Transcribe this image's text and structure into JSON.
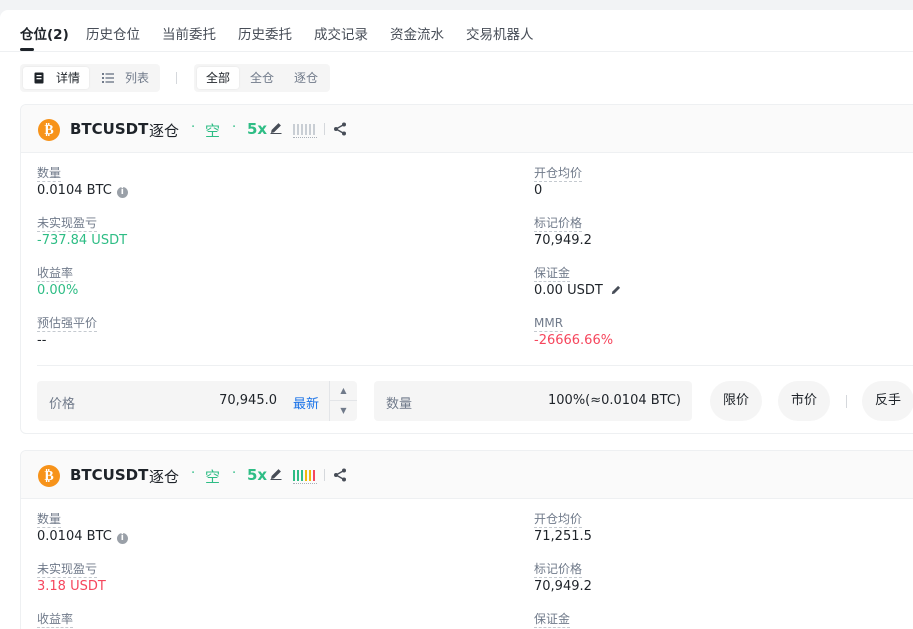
{
  "tabs": [
    {
      "label": "仓位(2)"
    },
    {
      "label": "历史仓位"
    },
    {
      "label": "当前委托"
    },
    {
      "label": "历史委托"
    },
    {
      "label": "成交记录"
    },
    {
      "label": "资金流水"
    },
    {
      "label": "交易机器人"
    }
  ],
  "view_toggle": {
    "detail": "详情",
    "list": "列表"
  },
  "filter": {
    "all": "全部",
    "cross": "全仓",
    "isolated": "逐仓"
  },
  "positions": [
    {
      "symbol": "BTCUSDT",
      "margin_mode": "逐仓",
      "sep": "·",
      "side": "空",
      "leverage": "5x",
      "quantity_label": "数量",
      "quantity": "0.0104 BTC",
      "entry_price_label": "开仓均价",
      "entry_price": "0",
      "upnl_label": "未实现盈亏",
      "upnl": "-737.84 USDT",
      "mark_price_label": "标记价格",
      "mark_price": "70,949.2",
      "roe_label": "收益率",
      "roe": "0.00%",
      "margin_label": "保证金",
      "margin": "0.00 USDT",
      "liq_price_label": "预估强平价",
      "liq_price": "--",
      "mmr_label": "MMR",
      "mmr": "-26666.66%",
      "close": {
        "price_label": "价格",
        "price": "70,945.0",
        "latest": "最新",
        "qty_label": "数量",
        "qty": "100%(≈0.0104 BTC)",
        "limit": "限价",
        "market": "市价",
        "reverse": "反手"
      }
    },
    {
      "symbol": "BTCUSDT",
      "margin_mode": "逐仓",
      "sep": "·",
      "side": "空",
      "leverage": "5x",
      "quantity_label": "数量",
      "quantity": "0.0104 BTC",
      "entry_price_label": "开仓均价",
      "entry_price": "71,251.5",
      "upnl_label": "未实现盈亏",
      "upnl": "3.18 USDT",
      "mark_price_label": "标记价格",
      "mark_price": "70,949.2",
      "roe_label": "收益率",
      "margin_label": "保证金"
    }
  ],
  "colors": {
    "positive": "#2ebd85",
    "negative": "#f6465d",
    "link": "#1a73e8",
    "coin": "#f7931a"
  },
  "icons": [
    "detail-icon",
    "list-icon",
    "bitcoin-icon",
    "edit-icon",
    "risk-bars-icon",
    "share-icon",
    "info-icon",
    "caret-up-icon",
    "caret-down-icon"
  ]
}
